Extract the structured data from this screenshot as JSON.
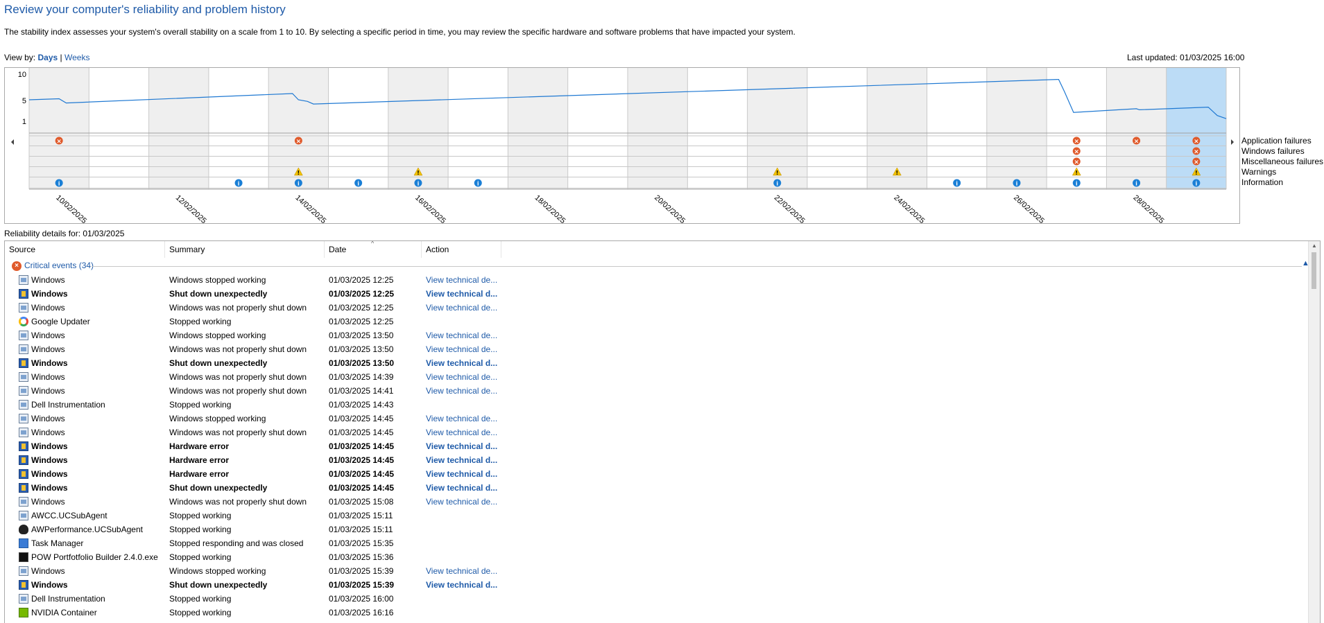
{
  "header": {
    "title": "Review your computer's reliability and problem history",
    "description": "The stability index assesses your system's overall stability on a scale from 1 to 10. By selecting a specific period in time, you may review the specific hardware and software problems that have impacted your system.",
    "view_by_label": "View by:",
    "days": "Days",
    "separator": "|",
    "weeks": "Weeks",
    "last_updated": "Last updated: 01/03/2025 16:00"
  },
  "chart_data": {
    "type": "line",
    "y_ticks": [
      "10",
      "5",
      "1"
    ],
    "ylim": [
      1,
      10
    ],
    "x_tick_labels": [
      "10/02/2025",
      "12/02/2025",
      "14/02/2025",
      "16/02/2025",
      "18/02/2025",
      "20/02/2025",
      "22/02/2025",
      "24/02/2025",
      "26/02/2025",
      "28/02/2025"
    ],
    "x_tick_columns": [
      0,
      2,
      4,
      6,
      8,
      10,
      12,
      14,
      16,
      18
    ],
    "columns": 20,
    "selected_column": 19,
    "stability_index": [
      [
        0.0,
        5.1
      ],
      [
        0.5,
        5.3
      ],
      [
        0.62,
        4.5
      ],
      [
        4.4,
        6.3
      ],
      [
        4.5,
        5.1
      ],
      [
        4.65,
        4.8
      ],
      [
        4.75,
        4.3
      ],
      [
        17.2,
        9.0
      ],
      [
        17.3,
        6.6
      ],
      [
        17.45,
        2.7
      ],
      [
        18.5,
        3.4
      ],
      [
        18.55,
        3.2
      ],
      [
        19.7,
        3.7
      ],
      [
        19.85,
        2.1
      ],
      [
        20.0,
        1.5
      ]
    ],
    "legend": [
      "Application failures",
      "Windows failures",
      "Miscellaneous failures",
      "Warnings",
      "Information"
    ],
    "events": {
      "application_failures": [
        0,
        4,
        17,
        18,
        19
      ],
      "windows_failures": [
        17,
        19
      ],
      "miscellaneous_failures": [
        17,
        19
      ],
      "warnings": [
        4,
        6,
        12,
        14,
        17,
        19
      ],
      "information": [
        0,
        3,
        4,
        5,
        6,
        7,
        12,
        15,
        16,
        17,
        18,
        19
      ]
    },
    "colors": {
      "line": "#1e78d2",
      "error": "#e05a2b",
      "warning": "#f2c200",
      "info": "#1a7fd6",
      "selected": "#bcdcf6",
      "shaded": "#efefef"
    }
  },
  "details": {
    "label": "Reliability details for: 01/03/2025",
    "columns": [
      "Source",
      "Summary",
      "Date",
      "Action"
    ],
    "group_label": "Critical events (34)",
    "rows": [
      {
        "icon": "window",
        "source": "Windows",
        "summary": "Windows stopped working",
        "date": "01/03/2025 12:25",
        "action": "View technical de...",
        "bold": false
      },
      {
        "icon": "shield",
        "source": "Windows",
        "summary": "Shut down unexpectedly",
        "date": "01/03/2025 12:25",
        "action": "View technical d...",
        "bold": true
      },
      {
        "icon": "window",
        "source": "Windows",
        "summary": "Windows was not properly shut down",
        "date": "01/03/2025 12:25",
        "action": "View technical de...",
        "bold": false
      },
      {
        "icon": "google",
        "source": "Google Updater",
        "summary": "Stopped working",
        "date": "01/03/2025 12:25",
        "action": "",
        "bold": false
      },
      {
        "icon": "window",
        "source": "Windows",
        "summary": "Windows stopped working",
        "date": "01/03/2025 13:50",
        "action": "View technical de...",
        "bold": false
      },
      {
        "icon": "window",
        "source": "Windows",
        "summary": "Windows was not properly shut down",
        "date": "01/03/2025 13:50",
        "action": "View technical de...",
        "bold": false
      },
      {
        "icon": "shield",
        "source": "Windows",
        "summary": "Shut down unexpectedly",
        "date": "01/03/2025 13:50",
        "action": "View technical d...",
        "bold": true
      },
      {
        "icon": "window",
        "source": "Windows",
        "summary": "Windows was not properly shut down",
        "date": "01/03/2025 14:39",
        "action": "View technical de...",
        "bold": false
      },
      {
        "icon": "window",
        "source": "Windows",
        "summary": "Windows was not properly shut down",
        "date": "01/03/2025 14:41",
        "action": "View technical de...",
        "bold": false
      },
      {
        "icon": "window",
        "source": "Dell Instrumentation",
        "summary": "Stopped working",
        "date": "01/03/2025 14:43",
        "action": "",
        "bold": false
      },
      {
        "icon": "window",
        "source": "Windows",
        "summary": "Windows stopped working",
        "date": "01/03/2025 14:45",
        "action": "View technical de...",
        "bold": false
      },
      {
        "icon": "window",
        "source": "Windows",
        "summary": "Windows was not properly shut down",
        "date": "01/03/2025 14:45",
        "action": "View technical de...",
        "bold": false
      },
      {
        "icon": "shield",
        "source": "Windows",
        "summary": "Hardware error",
        "date": "01/03/2025 14:45",
        "action": "View technical d...",
        "bold": true
      },
      {
        "icon": "shield",
        "source": "Windows",
        "summary": "Hardware error",
        "date": "01/03/2025 14:45",
        "action": "View technical d...",
        "bold": true
      },
      {
        "icon": "shield",
        "source": "Windows",
        "summary": "Hardware error",
        "date": "01/03/2025 14:45",
        "action": "View technical d...",
        "bold": true
      },
      {
        "icon": "shield",
        "source": "Windows",
        "summary": "Shut down unexpectedly",
        "date": "01/03/2025 14:45",
        "action": "View technical d...",
        "bold": true
      },
      {
        "icon": "window",
        "source": "Windows",
        "summary": "Windows was not properly shut down",
        "date": "01/03/2025 15:08",
        "action": "View technical de...",
        "bold": false
      },
      {
        "icon": "window",
        "source": "AWCC.UCSubAgent",
        "summary": "Stopped working",
        "date": "01/03/2025 15:11",
        "action": "",
        "bold": false
      },
      {
        "icon": "alien",
        "source": "AWPerformance.UCSubAgent",
        "summary": "Stopped working",
        "date": "01/03/2025 15:11",
        "action": "",
        "bold": false
      },
      {
        "icon": "task",
        "source": "Task Manager",
        "summary": "Stopped responding and was closed",
        "date": "01/03/2025 15:35",
        "action": "",
        "bold": false
      },
      {
        "icon": "pow",
        "source": "POW Portfotfolio Builder 2.4.0.exe",
        "summary": "Stopped working",
        "date": "01/03/2025 15:36",
        "action": "",
        "bold": false
      },
      {
        "icon": "window",
        "source": "Windows",
        "summary": "Windows stopped working",
        "date": "01/03/2025 15:39",
        "action": "View technical de...",
        "bold": false
      },
      {
        "icon": "shield",
        "source": "Windows",
        "summary": "Shut down unexpectedly",
        "date": "01/03/2025 15:39",
        "action": "View technical d...",
        "bold": true
      },
      {
        "icon": "window",
        "source": "Dell Instrumentation",
        "summary": "Stopped working",
        "date": "01/03/2025 16:00",
        "action": "",
        "bold": false
      },
      {
        "icon": "nvidia",
        "source": "NVIDIA Container",
        "summary": "Stopped working",
        "date": "01/03/2025 16:16",
        "action": "",
        "bold": false
      }
    ]
  }
}
